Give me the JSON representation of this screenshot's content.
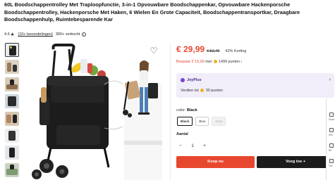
{
  "product": {
    "title": "60L Boodschappentrolley Met Traploopfunctie, 3-in-1 Opvouwbare Boodschappenkar, Opvouwbare Hackenporsche Boodschappentrolley, Hackenporsche Met Haken, 6 Wielen En Grote Capaciteit, Boodschappentransportkar, Draagbare Boodschappenhulp, Ruimtebesparende Kar",
    "rating": "4.6",
    "reviews": "(10+ beoordelingen)",
    "sold": "300+ verkocht",
    "rating_icon": "star-icon",
    "info_icon": "info-icon"
  },
  "price": {
    "current": "€ 29,99",
    "original": "€ 52,49",
    "discount": "42% Korting"
  },
  "savings": {
    "save_text": "Bespaar € 15,00",
    "with": "met",
    "points": "1499 punten"
  },
  "joyplus": {
    "name": "JoyPlus",
    "earn_prefix": "Verdien tot",
    "earn_points": "30 punten",
    "chevron": "›"
  },
  "color": {
    "label": "color:",
    "selected_value": "Black",
    "options": [
      "Black",
      "Blue",
      "Grey"
    ]
  },
  "quantity": {
    "label": "Aantal",
    "value": "1",
    "minus": "−",
    "plus": "+"
  },
  "actions": {
    "buy_now": "Koop nu",
    "add_to_cart": "Voeg toe +"
  },
  "gallery": {
    "thumbnail_count": 8,
    "more_icon": "chevron-down-icon"
  },
  "side_panel": {
    "items": [
      "Down",
      "Sho",
      "Re",
      "Fee"
    ]
  },
  "colors": {
    "accent": "#e8472f",
    "dark_button": "#1c1c1c",
    "joyplus_bg": "#f1edf9",
    "joyplus_brand": "#7a43d6",
    "coin": "#f2b01e"
  }
}
